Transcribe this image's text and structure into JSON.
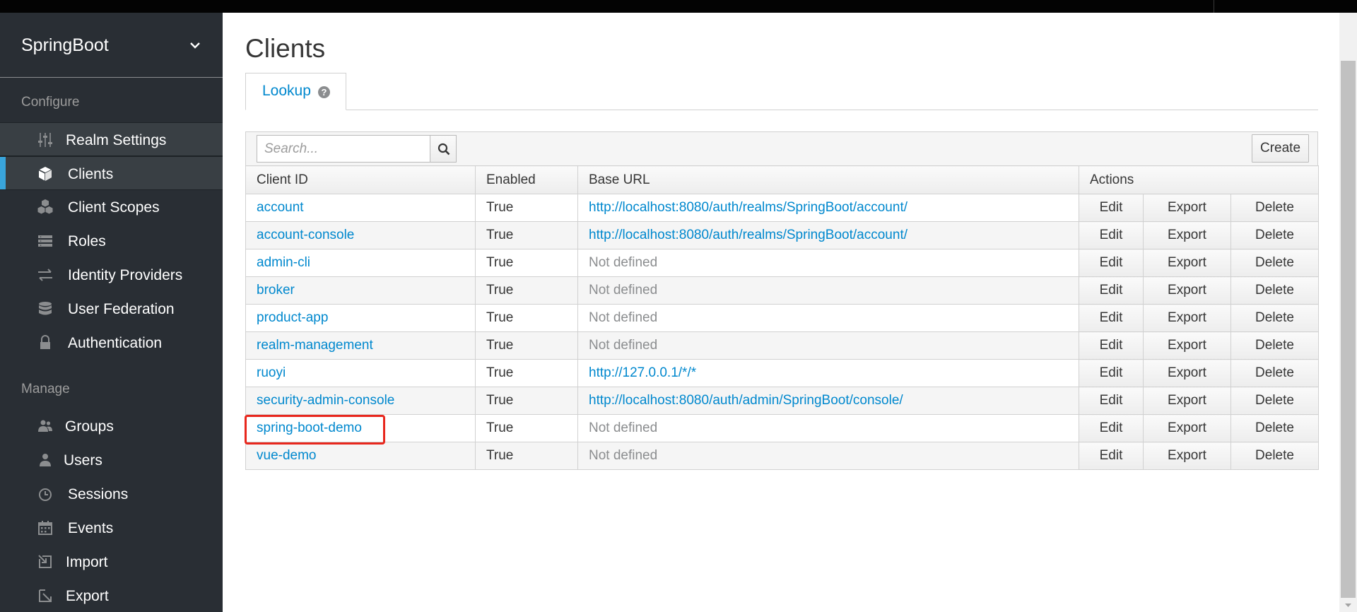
{
  "sidebar": {
    "realm_name": "SpringBoot",
    "configure_label": "Configure",
    "manage_label": "Manage",
    "configure_items": [
      {
        "label": "Realm Settings",
        "icon": "sliders-icon"
      },
      {
        "label": "Clients",
        "icon": "cube-icon"
      },
      {
        "label": "Client Scopes",
        "icon": "cubes-icon"
      },
      {
        "label": "Roles",
        "icon": "list-icon"
      },
      {
        "label": "Identity Providers",
        "icon": "exchange-icon"
      },
      {
        "label": "User Federation",
        "icon": "database-icon"
      },
      {
        "label": "Authentication",
        "icon": "lock-icon"
      }
    ],
    "manage_items": [
      {
        "label": "Groups",
        "icon": "users-icon"
      },
      {
        "label": "Users",
        "icon": "user-icon"
      },
      {
        "label": "Sessions",
        "icon": "clock-icon"
      },
      {
        "label": "Events",
        "icon": "calendar-icon"
      },
      {
        "label": "Import",
        "icon": "import-icon"
      },
      {
        "label": "Export",
        "icon": "export-icon"
      }
    ]
  },
  "main": {
    "title": "Clients",
    "tab_label": "Lookup",
    "search_placeholder": "Search...",
    "create_label": "Create",
    "columns": [
      "Client ID",
      "Enabled",
      "Base URL",
      "Actions"
    ],
    "action_labels": {
      "edit": "Edit",
      "export": "Export",
      "delete": "Delete"
    },
    "rows": [
      {
        "client_id": "account",
        "enabled": "True",
        "base_url": "http://localhost:8080/auth/realms/SpringBoot/account/",
        "defined": true
      },
      {
        "client_id": "account-console",
        "enabled": "True",
        "base_url": "http://localhost:8080/auth/realms/SpringBoot/account/",
        "defined": true
      },
      {
        "client_id": "admin-cli",
        "enabled": "True",
        "base_url": "Not defined",
        "defined": false
      },
      {
        "client_id": "broker",
        "enabled": "True",
        "base_url": "Not defined",
        "defined": false
      },
      {
        "client_id": "product-app",
        "enabled": "True",
        "base_url": "Not defined",
        "defined": false
      },
      {
        "client_id": "realm-management",
        "enabled": "True",
        "base_url": "Not defined",
        "defined": false
      },
      {
        "client_id": "ruoyi",
        "enabled": "True",
        "base_url": "http://127.0.0.1/*/*",
        "defined": true
      },
      {
        "client_id": "security-admin-console",
        "enabled": "True",
        "base_url": "http://localhost:8080/auth/admin/SpringBoot/console/",
        "defined": true
      },
      {
        "client_id": "spring-boot-demo",
        "enabled": "True",
        "base_url": "Not defined",
        "defined": false
      },
      {
        "client_id": "vue-demo",
        "enabled": "True",
        "base_url": "Not defined",
        "defined": false
      }
    ]
  },
  "colors": {
    "sidebar_bg": "#292e34",
    "link": "#0088ce",
    "active_marker": "#39a5dc",
    "highlight": "#e8271d"
  }
}
